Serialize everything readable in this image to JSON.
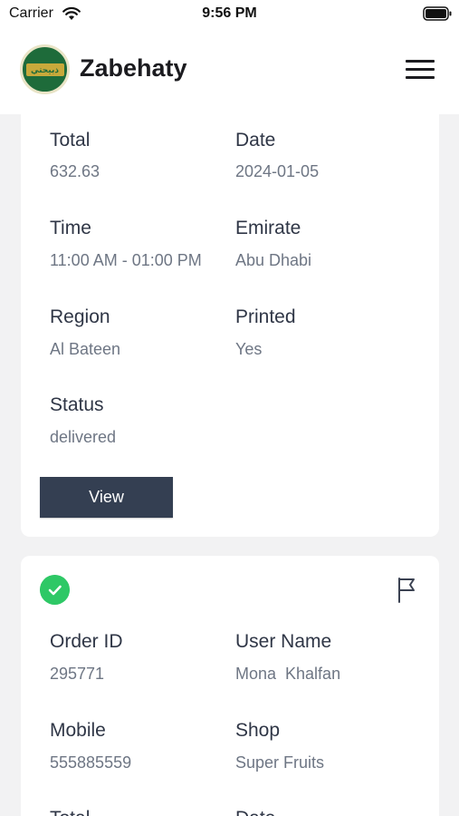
{
  "status_bar": {
    "carrier": "Carrier",
    "time": "9:56 PM"
  },
  "header": {
    "brand": "Zabehaty",
    "logo_text": "ذبيحتي"
  },
  "cards": [
    {
      "fields": [
        {
          "label": "Total",
          "value": "632.63"
        },
        {
          "label": "Date",
          "value": "2024-01-05"
        },
        {
          "label": "Time",
          "value": "11:00 AM - 01:00 PM"
        },
        {
          "label": "Emirate",
          "value": "Abu Dhabi"
        },
        {
          "label": "Region",
          "value": "Al Bateen"
        },
        {
          "label": "Printed",
          "value": "Yes"
        },
        {
          "label": "Status",
          "value": "delivered"
        }
      ],
      "view_label": "View"
    },
    {
      "fields": [
        {
          "label": "Order ID",
          "value": "295771"
        },
        {
          "label": "User Name",
          "value": "Mona  Khalfan"
        },
        {
          "label": "Mobile",
          "value": "555885559"
        },
        {
          "label": "Shop",
          "value": "Super Fruits"
        },
        {
          "label": "Total",
          "value": ""
        },
        {
          "label": "Date",
          "value": ""
        }
      ]
    }
  ],
  "colors": {
    "accent_button": "#343f52",
    "success": "#2ec866",
    "brand_green": "#1e6b3a"
  },
  "icons": [
    "wifi-icon",
    "battery-icon",
    "menu-icon",
    "check-circle-icon",
    "flag-icon"
  ]
}
